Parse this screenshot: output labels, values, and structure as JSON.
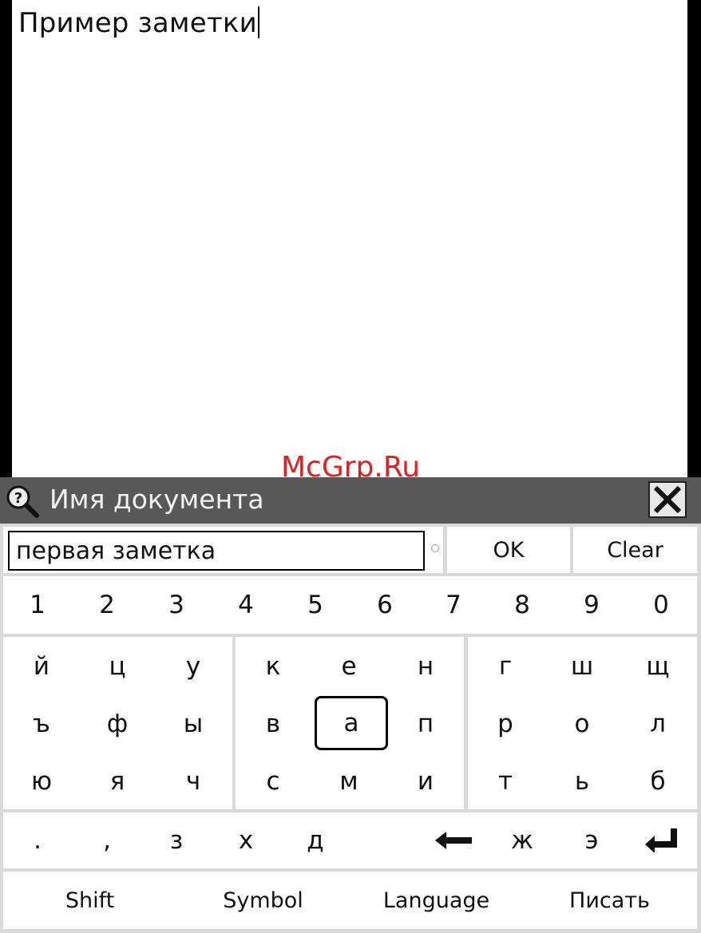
{
  "note": {
    "text": "Пример заметки"
  },
  "watermark": "McGrp.Ru",
  "dialog": {
    "title": "Имя документа",
    "title_icon": "magnifier-help-icon",
    "close_icon": "close-icon",
    "input_value": "первая заметка",
    "ok_label": "OK",
    "clear_label": "Clear"
  },
  "keyboard": {
    "digits": [
      "1",
      "2",
      "3",
      "4",
      "5",
      "6",
      "7",
      "8",
      "9",
      "0"
    ],
    "block1": [
      [
        "й",
        "ц",
        "у"
      ],
      [
        "ъ",
        "ф",
        "ы"
      ],
      [
        "ю",
        "я",
        "ч"
      ]
    ],
    "block2": [
      [
        "к",
        "е",
        "н"
      ],
      [
        "в",
        "а",
        "п"
      ],
      [
        "с",
        "м",
        "и"
      ]
    ],
    "block3": [
      [
        "г",
        "ш",
        "щ"
      ],
      [
        "р",
        "о",
        "л"
      ],
      [
        "т",
        "ь",
        "б"
      ]
    ],
    "selected_key": "а",
    "last_row": [
      ".",
      ",",
      "з",
      "х",
      "д",
      "",
      "ж",
      "э"
    ],
    "backspace_icon": "left-arrow-icon",
    "enter_icon": "enter-icon",
    "bottom": [
      "Shift",
      "Symbol",
      "Language",
      "Писать"
    ]
  }
}
